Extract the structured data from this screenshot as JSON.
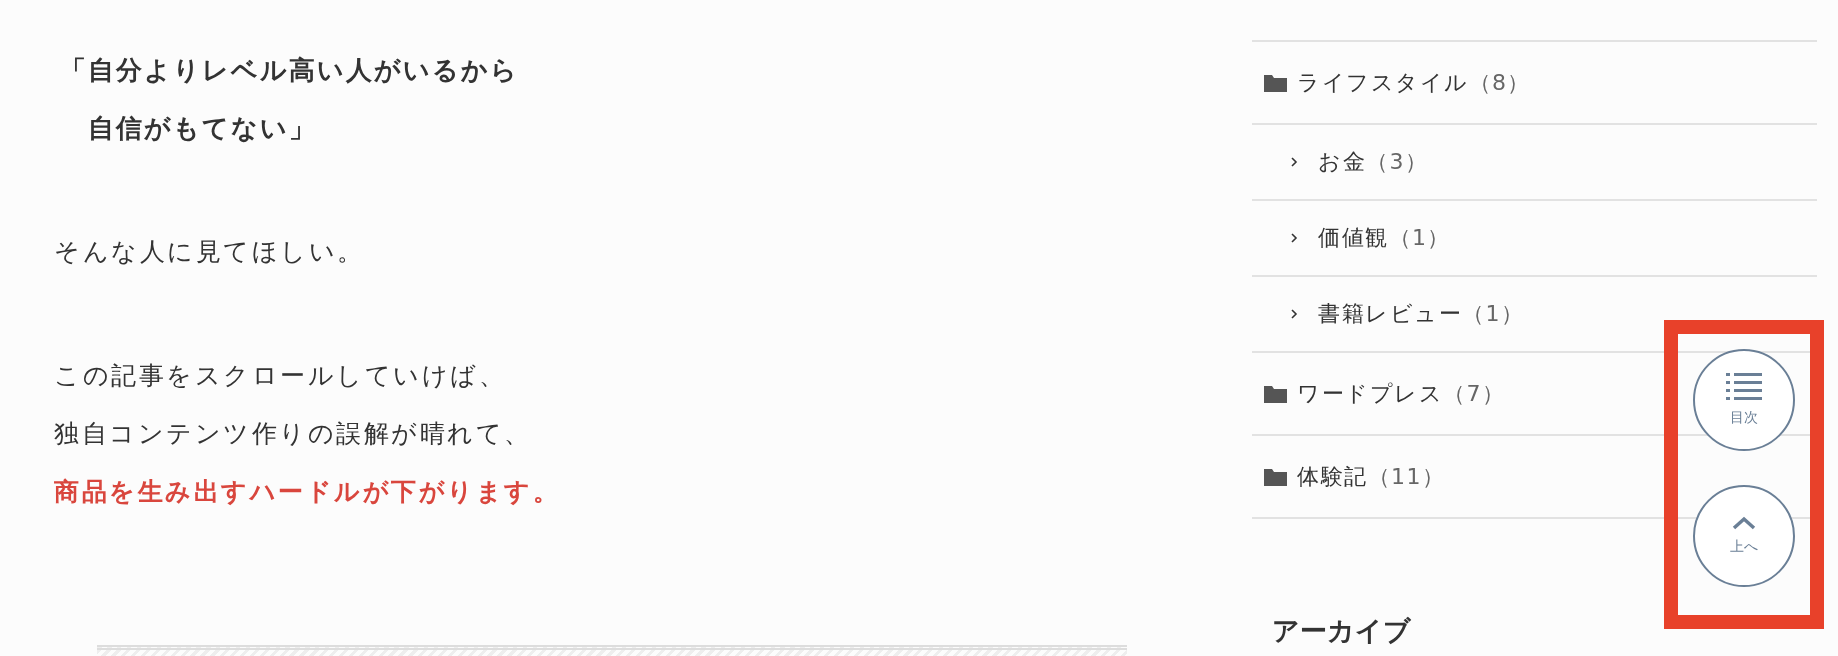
{
  "article": {
    "quote_lines": [
      "「自分よりレベル高い人がいるから",
      "自信がもてない」"
    ],
    "paragraphs": [
      {
        "lines": [
          {
            "text": "そんな人に見てほしい。",
            "kind": "normal"
          }
        ]
      },
      {
        "lines": [
          {
            "text": "この記事をスクロールしていけば、",
            "kind": "normal"
          },
          {
            "text": "独自コンテンツ作りの誤解が晴れて、",
            "kind": "normal"
          },
          {
            "text": "商品を生み出すハードルが下がります。",
            "kind": "highlight"
          }
        ]
      }
    ]
  },
  "sidebar": {
    "categories": [
      {
        "label": "ライフスタイル",
        "count": "（8）",
        "children": [
          {
            "label": "お金",
            "count": "（3）"
          },
          {
            "label": "価値観",
            "count": "（1）"
          },
          {
            "label": "書籍レビュー",
            "count": "（1）"
          }
        ]
      },
      {
        "label": "ワードプレス",
        "count": "（7）"
      },
      {
        "label": "体験記",
        "count": "（11）"
      }
    ],
    "archive_heading": "アーカイブ"
  },
  "floating_buttons": [
    {
      "label": "目次",
      "kind": "toc"
    },
    {
      "label": "上へ",
      "kind": "top"
    }
  ]
}
